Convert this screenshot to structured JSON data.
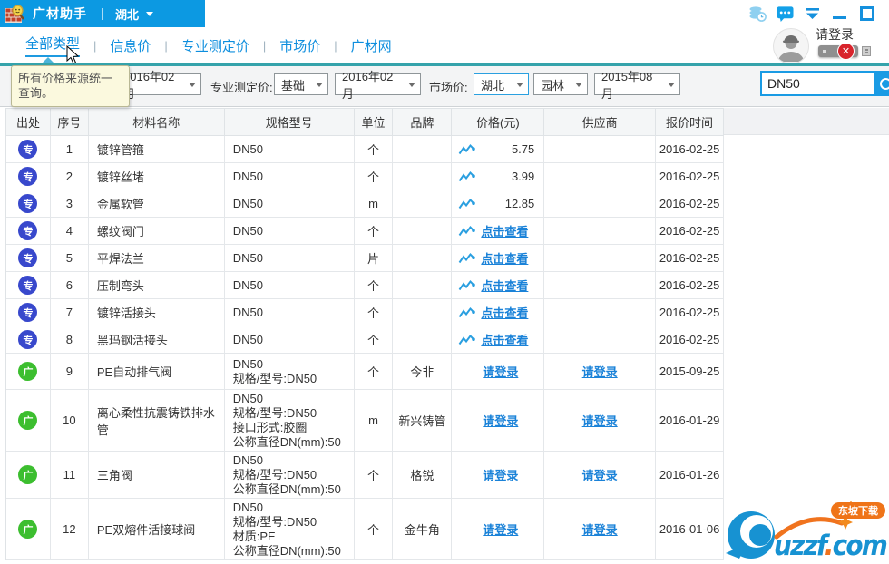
{
  "app": {
    "title": "广材助手",
    "region": "湖北",
    "login_label": "请登录"
  },
  "nav": {
    "separator": "|",
    "tabs": [
      {
        "label": "全部类型",
        "active": true
      },
      {
        "label": "信息价",
        "active": false
      },
      {
        "label": "专业测定价",
        "active": false
      },
      {
        "label": "市场价",
        "active": false
      },
      {
        "label": "广材网",
        "active": false
      }
    ]
  },
  "tooltip": {
    "text": "所有价格来源统一查询。"
  },
  "filters": {
    "info_month": "2016年02月",
    "pro_label": "专业测定价:",
    "pro_type": "基础",
    "pro_month": "2016年02月",
    "market_label": "市场价:",
    "market_region": "湖北",
    "market_cat": "园林",
    "market_month": "2015年08月",
    "search": "DN50"
  },
  "links": {
    "view": "点击查看",
    "login": "请登录"
  },
  "table": {
    "headers": [
      "出处",
      "序号",
      "材料名称",
      "规格型号",
      "单位",
      "品牌",
      "价格(元)",
      "供应商",
      "报价时间"
    ],
    "rows": [
      {
        "source": "专",
        "source_type": "pro",
        "seq": "1",
        "name": "镀锌管箍",
        "spec": [
          "DN50"
        ],
        "unit": "个",
        "brand": "",
        "price": {
          "kind": "value",
          "value": "5.75"
        },
        "supplier": "",
        "date": "2016-02-25"
      },
      {
        "source": "专",
        "source_type": "pro",
        "seq": "2",
        "name": "镀锌丝堵",
        "spec": [
          "DN50"
        ],
        "unit": "个",
        "brand": "",
        "price": {
          "kind": "value",
          "value": "3.99"
        },
        "supplier": "",
        "date": "2016-02-25"
      },
      {
        "source": "专",
        "source_type": "pro",
        "seq": "3",
        "name": "金属软管",
        "spec": [
          "DN50"
        ],
        "unit": "m",
        "brand": "",
        "price": {
          "kind": "value",
          "value": "12.85"
        },
        "supplier": "",
        "date": "2016-02-25"
      },
      {
        "source": "专",
        "source_type": "pro",
        "seq": "4",
        "name": "螺纹阀门",
        "spec": [
          "DN50"
        ],
        "unit": "个",
        "brand": "",
        "price": {
          "kind": "view"
        },
        "supplier": "",
        "date": "2016-02-25"
      },
      {
        "source": "专",
        "source_type": "pro",
        "seq": "5",
        "name": "平焊法兰",
        "spec": [
          "DN50"
        ],
        "unit": "片",
        "brand": "",
        "price": {
          "kind": "view"
        },
        "supplier": "",
        "date": "2016-02-25"
      },
      {
        "source": "专",
        "source_type": "pro",
        "seq": "6",
        "name": "压制弯头",
        "spec": [
          "DN50"
        ],
        "unit": "个",
        "brand": "",
        "price": {
          "kind": "view"
        },
        "supplier": "",
        "date": "2016-02-25"
      },
      {
        "source": "专",
        "source_type": "pro",
        "seq": "7",
        "name": "镀锌活接头",
        "spec": [
          "DN50"
        ],
        "unit": "个",
        "brand": "",
        "price": {
          "kind": "view"
        },
        "supplier": "",
        "date": "2016-02-25"
      },
      {
        "source": "专",
        "source_type": "pro",
        "seq": "8",
        "name": "黑玛钢活接头",
        "spec": [
          "DN50"
        ],
        "unit": "个",
        "brand": "",
        "price": {
          "kind": "view"
        },
        "supplier": "",
        "date": "2016-02-25"
      },
      {
        "source": "广",
        "source_type": "guang",
        "seq": "9",
        "name": "PE自动排气阀",
        "spec": [
          "DN50",
          "规格/型号:DN50"
        ],
        "unit": "个",
        "brand": "今非",
        "price": {
          "kind": "login"
        },
        "supplier": "login",
        "date": "2015-09-25"
      },
      {
        "source": "广",
        "source_type": "guang",
        "seq": "10",
        "name": "离心柔性抗震铸铁排水管",
        "spec": [
          "DN50",
          "规格/型号:DN50",
          "接口形式:胶圈",
          "公称直径DN(mm):50"
        ],
        "unit": "m",
        "brand": "新兴铸管",
        "price": {
          "kind": "login"
        },
        "supplier": "login",
        "date": "2016-01-29"
      },
      {
        "source": "广",
        "source_type": "guang",
        "seq": "11",
        "name": "三角阀",
        "spec": [
          "DN50",
          "规格/型号:DN50",
          "公称直径DN(mm):50"
        ],
        "unit": "个",
        "brand": "格锐",
        "price": {
          "kind": "login"
        },
        "supplier": "login",
        "date": "2016-01-26"
      },
      {
        "source": "广",
        "source_type": "guang",
        "seq": "12",
        "name": "PE双熔件活接球阀",
        "spec": [
          "DN50",
          "规格/型号:DN50",
          "材质:PE",
          "公称直径DN(mm):50"
        ],
        "unit": "个",
        "brand": "金牛角",
        "price": {
          "kind": "login"
        },
        "supplier": "login",
        "date": "2016-01-06"
      }
    ]
  },
  "watermark": {
    "name": "uzzf",
    "dot": ".",
    "domain": "com",
    "badge": "东坡下载"
  },
  "icons": {
    "app-logo-icon": "brick-wall-with-magnifier",
    "data-history-icon": "coin-stack-clock",
    "message-icon": "chat-bubble-dots",
    "collapse-icon": "bar-with-down-triangle",
    "minimize-button": "horizontal-bar",
    "maximize-button": "square-outline",
    "avatar-icon": "worker-with-helmet",
    "usb-disconnected-icon": "usb-drive-red-x",
    "dropdown-caret-icon": "caret-down",
    "search-icon": "magnifier-circle",
    "trend-chart-icon": "line-chart",
    "mouse-cursor-icon": "arrow-pointer",
    "watermark-logo-icon": "blue-swoosh-circle"
  },
  "colors": {
    "titlebar_blue": "#0c99e2",
    "accent_blue": "#1590dd",
    "teal_line": "#35a3ab",
    "link_blue": "#1a82d8",
    "badge_pro": "#3848cc",
    "badge_guang": "#3cbe2f",
    "tooltip_bg": "#fbf9de",
    "orange": "#f0731e"
  }
}
